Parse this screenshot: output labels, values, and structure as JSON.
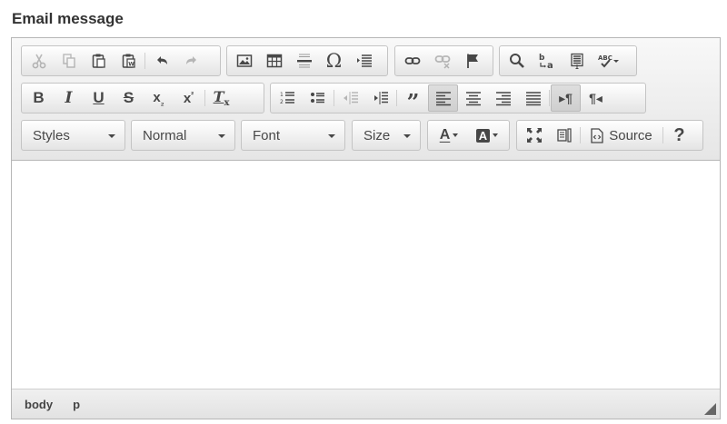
{
  "field": {
    "label": "Email message"
  },
  "toolbar": {
    "source_label": "Source",
    "help_label": "?",
    "styles_combo": "Styles",
    "format_combo": "Normal",
    "font_combo": "Font",
    "size_combo": "Size"
  },
  "statusbar": {
    "path": [
      "body",
      "p"
    ]
  },
  "colors": {
    "toolbar_bg": "#e6e6e6",
    "border": "#b6b6b6",
    "icon": "#474747",
    "active_button": "#d6d6d6"
  },
  "icons": {
    "clipboard": [
      "cut-icon",
      "copy-icon",
      "paste-icon",
      "paste-from-word-icon"
    ],
    "history": [
      "undo-icon",
      "redo-icon"
    ],
    "insert": [
      "image-icon",
      "table-icon",
      "horizontal-line-icon",
      "special-char-icon",
      "page-break-icon"
    ],
    "links": [
      "link-icon",
      "unlink-icon",
      "anchor-icon"
    ],
    "editing": [
      "find-icon",
      "replace-icon",
      "select-all-icon",
      "spellcheck-icon"
    ],
    "basic": [
      "bold-icon",
      "italic-icon",
      "underline-icon",
      "strike-icon",
      "subscript-icon",
      "superscript-icon",
      "remove-format-icon"
    ],
    "paragraph": [
      "numbered-list-icon",
      "bulleted-list-icon",
      "outdent-icon",
      "indent-icon",
      "blockquote-icon",
      "align-left-icon",
      "align-center-icon",
      "align-right-icon",
      "justify-icon",
      "ltr-icon",
      "rtl-icon"
    ],
    "colors": [
      "text-color-icon",
      "bg-color-icon"
    ],
    "tools": [
      "maximize-icon",
      "show-blocks-icon",
      "source-icon",
      "help-icon"
    ]
  },
  "state": {
    "disabled": [
      "cut",
      "copy",
      "redo",
      "unlink",
      "outdent"
    ],
    "active": [
      "align-left",
      "ltr"
    ]
  }
}
